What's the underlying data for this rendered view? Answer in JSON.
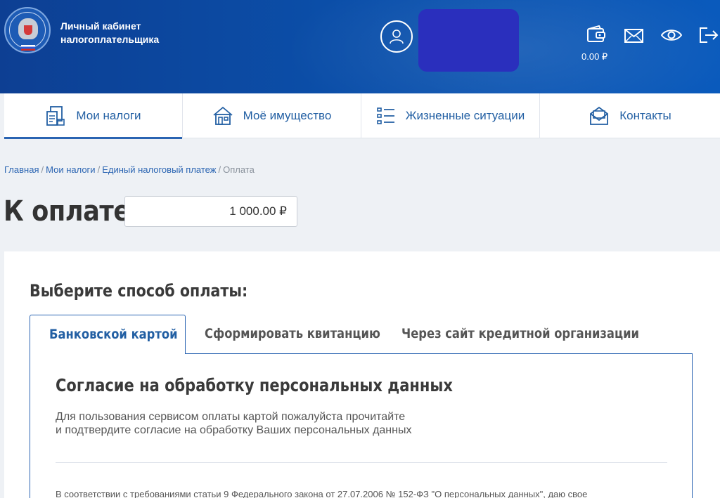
{
  "header": {
    "title_line1": "Личный кабинет",
    "title_line2": "налогоплательщика",
    "balance": "0.00 ₽",
    "emblem_text": "ФЕДЕРАЛЬНАЯ НАЛОГОВАЯ СЛУЖБА",
    "icons": [
      "user-icon",
      "wallet-icon",
      "mail-icon",
      "eye-icon",
      "logout-icon"
    ]
  },
  "nav": {
    "items": [
      {
        "label": "Мои налоги",
        "icon": "tax-documents-icon",
        "active": true
      },
      {
        "label": "Моё имущество",
        "icon": "property-icon",
        "active": false
      },
      {
        "label": "Жизненные ситуации",
        "icon": "list-icon",
        "active": false
      },
      {
        "label": "Контакты",
        "icon": "contacts-icon",
        "active": false
      }
    ]
  },
  "breadcrumb": {
    "items": [
      "Главная",
      "Мои налоги",
      "Единый налоговый платеж",
      "Оплата"
    ],
    "separator": "/"
  },
  "payment": {
    "title": "К оплате:",
    "amount": "1 000.00 ₽"
  },
  "method": {
    "heading": "Выберите способ оплаты:",
    "tabs": [
      {
        "label": "Банковской картой",
        "active": true
      },
      {
        "label": "Сформировать квитанцию",
        "active": false
      },
      {
        "label": "Через сайт кредитной организации",
        "active": false
      }
    ]
  },
  "consent": {
    "title": "Согласие на обработку персональных данных",
    "text_line1": "Для пользования сервисом оплаты картой пожалуйста прочитайте",
    "text_line2": "и подтвердите согласие на обработку Ваших персональных данных",
    "law_text": "В соответствии с требованиями статьи 9 Федерального закона от 27.07.2006 № 152-ФЗ \"О персональных данных\", даю свое"
  },
  "colors": {
    "header_bg": "#0b4ea8",
    "accent": "#2a64b2",
    "user_box": "#2a2fbd",
    "page_bg": "#eef1f5"
  }
}
